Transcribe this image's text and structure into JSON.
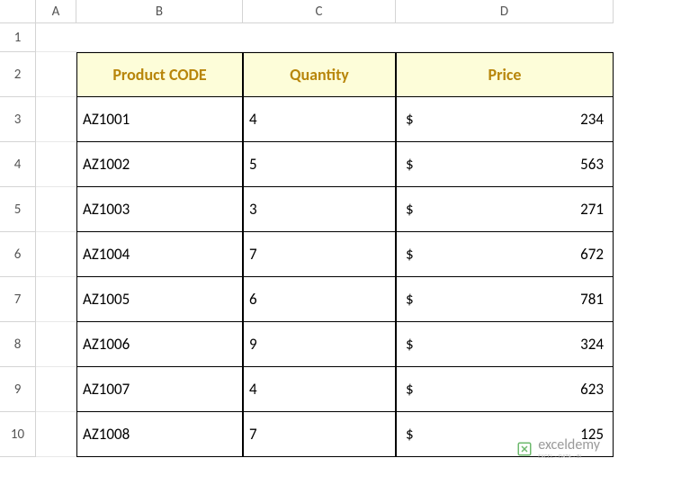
{
  "columns": [
    "",
    "A",
    "B",
    "C",
    "D"
  ],
  "row_labels": [
    "1",
    "2",
    "3",
    "4",
    "5",
    "6",
    "7",
    "8",
    "9",
    "10"
  ],
  "table": {
    "headers": [
      "Product CODE",
      "Quantity",
      "Price"
    ],
    "currency": "$",
    "rows": [
      {
        "code": "AZ1001",
        "qty": "4",
        "price": "234"
      },
      {
        "code": "AZ1002",
        "qty": "5",
        "price": "563"
      },
      {
        "code": "AZ1003",
        "qty": "3",
        "price": "271"
      },
      {
        "code": "AZ1004",
        "qty": "7",
        "price": "672"
      },
      {
        "code": "AZ1005",
        "qty": "6",
        "price": "781"
      },
      {
        "code": "AZ1006",
        "qty": "9",
        "price": "324"
      },
      {
        "code": "AZ1007",
        "qty": "4",
        "price": "623"
      },
      {
        "code": "AZ1008",
        "qty": "7",
        "price": "125"
      }
    ]
  },
  "watermark": {
    "name": "exceldemy",
    "sub": "EXCEL · DATA · BI"
  },
  "chart_data": {
    "type": "table",
    "title": "",
    "columns": [
      "Product CODE",
      "Quantity",
      "Price"
    ],
    "data": [
      [
        "AZ1001",
        4,
        234
      ],
      [
        "AZ1002",
        5,
        563
      ],
      [
        "AZ1003",
        3,
        271
      ],
      [
        "AZ1004",
        7,
        672
      ],
      [
        "AZ1005",
        6,
        781
      ],
      [
        "AZ1006",
        9,
        324
      ],
      [
        "AZ1007",
        4,
        623
      ],
      [
        "AZ1008",
        7,
        125
      ]
    ]
  }
}
